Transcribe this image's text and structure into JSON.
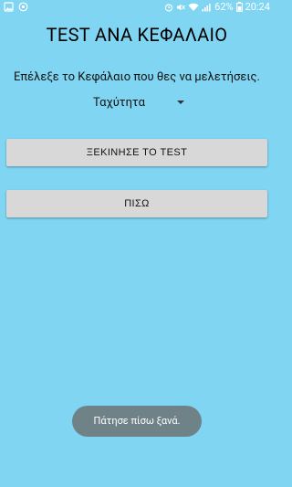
{
  "status_bar": {
    "battery_percent": "62%",
    "time": "20:24"
  },
  "screen": {
    "title": "TEST ΑΝΑ ΚΕΦΑΛΑΙΟ",
    "instruction": "Επέλεξε το Κεφάλαιο που θες να μελετήσεις.",
    "chapter_spinner": {
      "selected": "Ταχύτητα"
    },
    "start_button_label": "ΞΕΚΙΝΗΣΕ ΤΟ TEST",
    "back_button_label": "ΠΙΣΩ"
  },
  "toast": {
    "message": "Πάτησε πίσω ξανά."
  },
  "colors": {
    "background": "#80d6f2",
    "button": "#d8d8d8",
    "toast": "#6e8288"
  }
}
